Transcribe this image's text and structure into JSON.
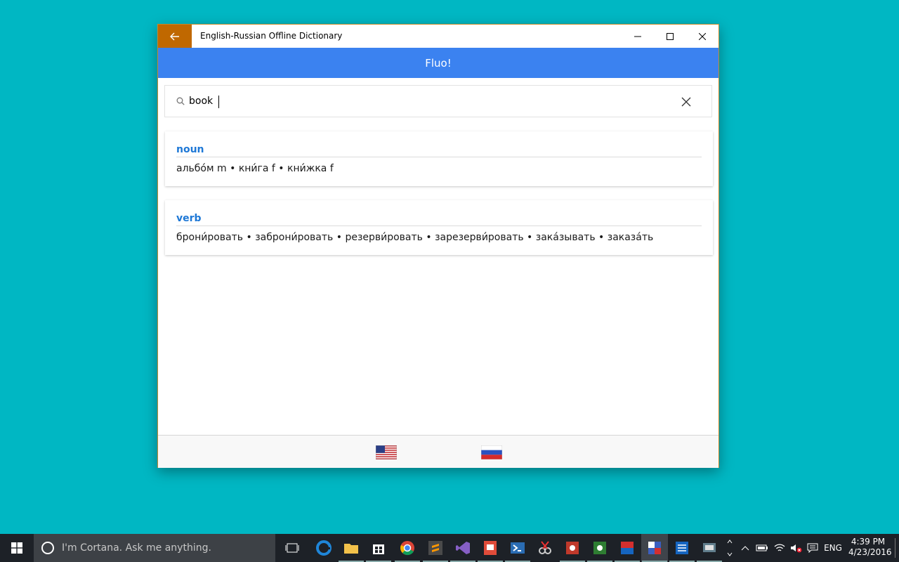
{
  "window": {
    "title": "English-Russian Offline Dictionary",
    "accent_color": "#c06800"
  },
  "app": {
    "header": "Fluo!",
    "header_color": "#3b82f0"
  },
  "search": {
    "value": "book",
    "placeholder": ""
  },
  "results": [
    {
      "pos": "noun",
      "translations": [
        "альбо́м m",
        "кни́га f",
        "кни́жка f"
      ]
    },
    {
      "pos": "verb",
      "translations": [
        "брони́ровать",
        "заброни́ровать",
        "резерви́ровать",
        "зарезерви́ровать",
        "зака́зывать",
        "заказа́ть"
      ]
    }
  ],
  "footer": {
    "source_language": "flag-us-icon",
    "target_language": "flag-ru-icon"
  },
  "taskbar": {
    "cortana_placeholder": "I'm Cortana. Ask me anything.",
    "language": "ENG",
    "time": "4:39 PM",
    "date": "4/23/2016"
  }
}
